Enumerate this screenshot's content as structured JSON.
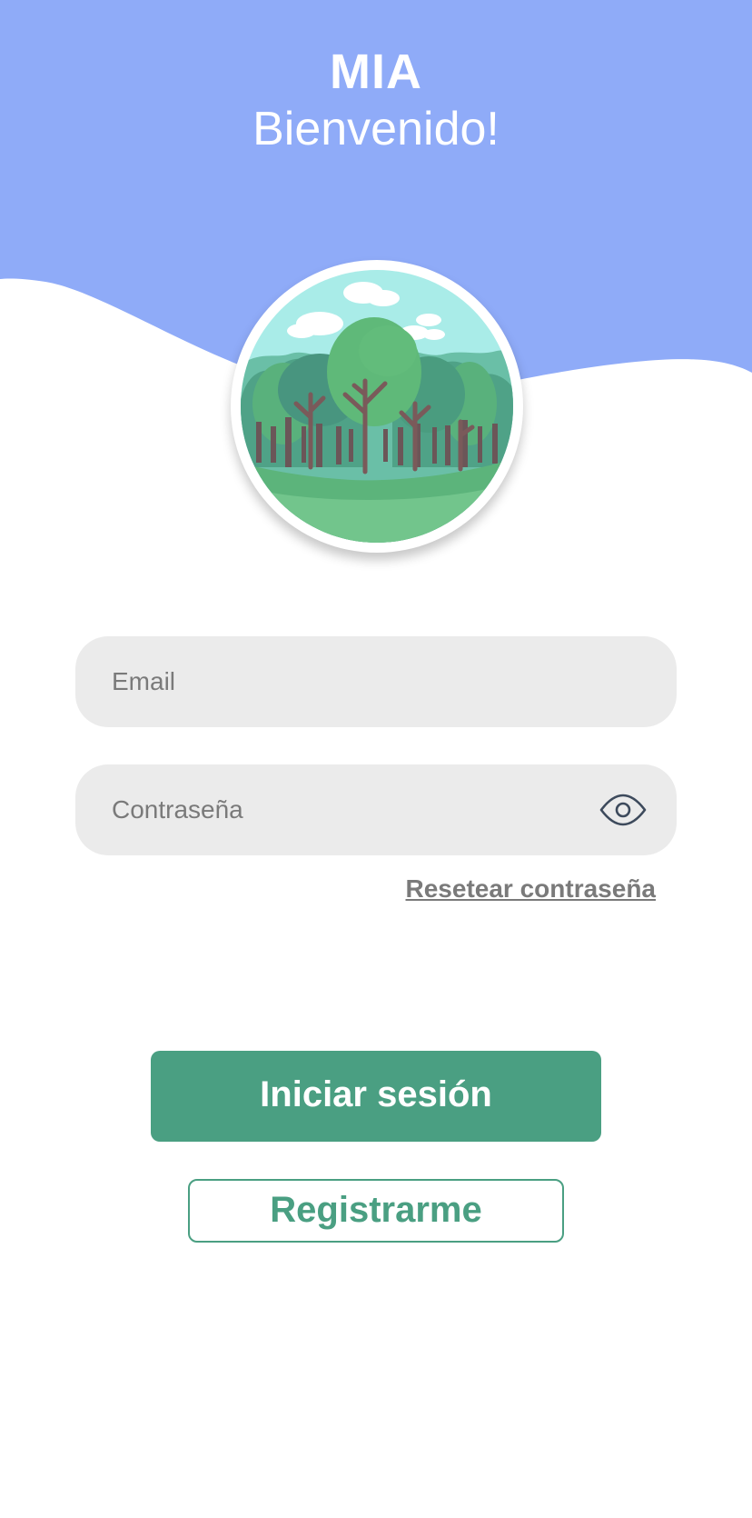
{
  "header": {
    "title": "MIA",
    "subtitle": "Bienvenido!",
    "background_color": "#8fabf8"
  },
  "avatar": {
    "icon": "forest-landscape-icon"
  },
  "login_form": {
    "email": {
      "value": "",
      "placeholder": "Email"
    },
    "password": {
      "value": "",
      "placeholder": "Contraseña",
      "toggle_icon": "eye-icon"
    },
    "reset_password_label": "Resetear contraseña",
    "login_label": "Iniciar sesión",
    "register_label": "Registrarme"
  },
  "colors": {
    "accent": "#4a9f82",
    "field_background": "#ebebeb",
    "muted_text": "#7a7a7a"
  }
}
